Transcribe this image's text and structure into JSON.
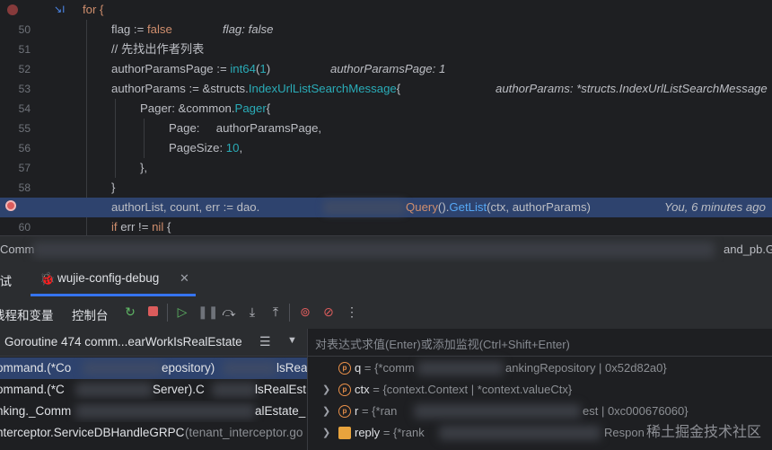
{
  "editor": {
    "lines": [
      {
        "num": "",
        "code": "for {"
      },
      {
        "num": "50",
        "code": "flag := false",
        "inline": "flag: false"
      },
      {
        "num": "51",
        "code": "// 先找出作者列表"
      },
      {
        "num": "52",
        "code": "authorParamsPage := int64(1)",
        "inline": "authorParamsPage: 1"
      },
      {
        "num": "53",
        "code": "authorParams := &structs.IndexUrlListSearchMessage{",
        "inline": "authorParams: *structs.IndexUrlListSearchMessage"
      },
      {
        "num": "54",
        "code": "Pager: &common.Pager{"
      },
      {
        "num": "55",
        "code": "Page:     authorParamsPage,"
      },
      {
        "num": "56",
        "code": "PageSize: 10,"
      },
      {
        "num": "57",
        "code": "},"
      },
      {
        "num": "58",
        "code": "}"
      },
      {
        "num": "",
        "code": "authorList, count, err := dao.",
        "code_tail": "Query().GetList(ctx, authorParams)",
        "inline": "You, 6 minutes ago"
      },
      {
        "num": "60",
        "code": "if err != nil {"
      }
    ]
  },
  "statusbar": {
    "left": "Comm",
    "right": "and_pb.G"
  },
  "debug": {
    "title": "调试",
    "tab_label": "wujie-config-debug",
    "threads_label": "线程和变量",
    "console_label": "控制台",
    "goroutine": "Goroutine 474 comm...earWorkIsRealEstate",
    "eval_placeholder": "对表达式求值(Enter)或添加监视(Ctrl+Shift+Enter)",
    "frames": [
      {
        "a": "ommand.(*Co",
        "b": "epository)",
        "c": "lsRea"
      },
      {
        "a": "ommand.(*C",
        "b": "Server).C",
        "c": "lsRealEst"
      },
      {
        "a": "nking._Comm",
        "b": "",
        "c": "alEstate_"
      },
      {
        "a": "nterceptor.ServiceDBHandleGRPC",
        "b": "(tenant_interceptor.go",
        "c": ""
      }
    ],
    "variables": [
      {
        "name": "q",
        "value": "= {*comm",
        "tail": "ankingRepository | 0x52d82a0}",
        "expand": false
      },
      {
        "name": "ctx",
        "value": "= {context.Context | *context.valueCtx}",
        "tail": "",
        "expand": true
      },
      {
        "name": "r",
        "value": "= {*ran",
        "tail": "est | 0xc000676060}",
        "expand": true
      },
      {
        "name": "reply",
        "value": "= {*rank",
        "tail": "Respon",
        "expand": true
      }
    ],
    "watermark": "稀土掘金技术社区"
  }
}
